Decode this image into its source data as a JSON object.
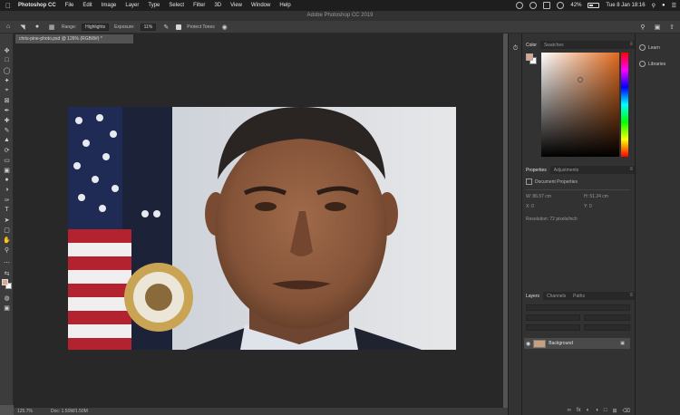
{
  "menubar": {
    "app_name": "Photoshop CC",
    "items": [
      "File",
      "Edit",
      "Image",
      "Layer",
      "Type",
      "Select",
      "Filter",
      "3D",
      "View",
      "Window",
      "Help"
    ],
    "battery": "42%",
    "clock": "Tue 8 Jan 18:16"
  },
  "window": {
    "title": "Adobe Photoshop CC 2019"
  },
  "options": {
    "range_label": "Range:",
    "range_value": "Highlights",
    "exposure_label": "Exposure:",
    "exposure_value": "11%",
    "protect_tones": "Protect Tones"
  },
  "document": {
    "tab_label": "chris-pine-photo.psd @ 126% (RGB/8#) *"
  },
  "statusbar": {
    "zoom": "125.7%",
    "doc_size": "Doc: 1.50M/1.50M"
  },
  "color_panel": {
    "tabs": [
      "Color",
      "Swatches"
    ],
    "foreground": "#dca88c",
    "background": "#ffffff"
  },
  "properties_panel": {
    "tabs": [
      "Properties",
      "Adjustments"
    ],
    "title": "Document Properties",
    "w_label": "W: 86.57 cm",
    "h_label": "H: 51.24 cm",
    "x_label": "X: 0",
    "y_label": "Y: 0",
    "resolution": "Resolution: 72 pixels/inch"
  },
  "layers_panel": {
    "tabs": [
      "Layers",
      "Channels",
      "Paths"
    ],
    "layer_name": "Background"
  },
  "right_dock": {
    "items": [
      "Learn",
      "Libraries"
    ]
  }
}
